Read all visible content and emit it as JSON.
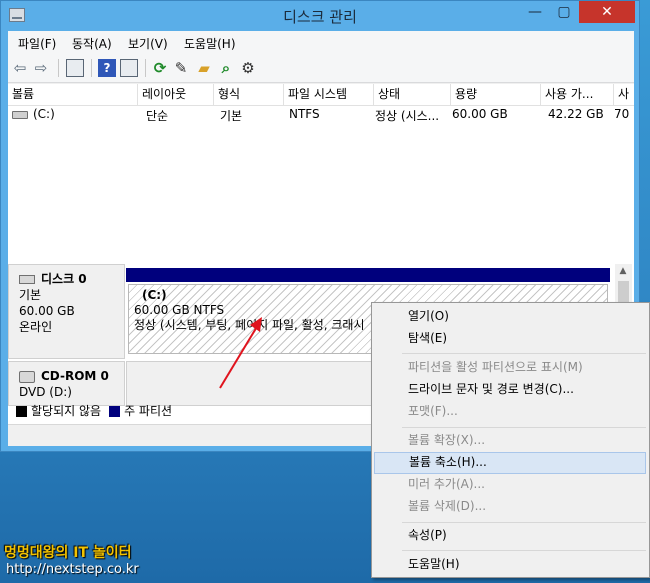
{
  "window": {
    "title": "디스크 관리",
    "controls": {
      "minimize": "—",
      "maximize": "▢",
      "close": "✕"
    }
  },
  "menubar": [
    {
      "label": "파일(F)"
    },
    {
      "label": "동작(A)"
    },
    {
      "label": "보기(V)"
    },
    {
      "label": "도움말(H)"
    }
  ],
  "toolbar": {
    "icons": [
      "back-arrow-icon",
      "forward-arrow-icon",
      "console-tree-icon",
      "help-icon",
      "properties-view-icon",
      "refresh-icon",
      "properties-icon",
      "open-folder-icon",
      "search-icon",
      "settings-icon"
    ],
    "help_glyph": "?"
  },
  "volume_list": {
    "columns": [
      "볼륨",
      "레이아웃",
      "형식",
      "파일 시스템",
      "상태",
      "용량",
      "사용 가...",
      "사"
    ],
    "rows": [
      {
        "volume": "(C:)",
        "layout": "단순",
        "type": "기본",
        "filesystem": "NTFS",
        "status": "정상 (시스...",
        "capacity": "60.00 GB",
        "free": "42.22 GB",
        "pct": "70"
      }
    ]
  },
  "disks": {
    "disk0": {
      "title": "디스크 0",
      "kind": "기본",
      "size": "60.00 GB",
      "state": "온라인",
      "partition": {
        "name": "(C:)",
        "size_fs": "60.00 GB NTFS",
        "status": "정상 (시스템, 부팅, 페이지 파일, 활성, 크래시"
      }
    },
    "cdrom0": {
      "title": "CD-ROM 0",
      "drive": "DVD (D:)"
    }
  },
  "legend": {
    "items": [
      {
        "label": "할당되지 않음",
        "color": "#000000"
      },
      {
        "label": "주 파티션",
        "color": "#00007d"
      }
    ]
  },
  "context_menu": {
    "items": [
      {
        "label": "열기(O)",
        "enabled": true
      },
      {
        "label": "탐색(E)",
        "enabled": true
      },
      {
        "label": "파티션을 활성 파티션으로 표시(M)",
        "enabled": false
      },
      {
        "label": "드라이브 문자 및 경로 변경(C)...",
        "enabled": true
      },
      {
        "label": "포맷(F)...",
        "enabled": false
      },
      {
        "label": "볼륨 확장(X)...",
        "enabled": false
      },
      {
        "label": "볼륨 축소(H)...",
        "enabled": true,
        "highlighted": true
      },
      {
        "label": "미러 추가(A)...",
        "enabled": false
      },
      {
        "label": "볼륨 삭제(D)...",
        "enabled": false
      },
      {
        "label": "속성(P)",
        "enabled": true
      },
      {
        "label": "도움말(H)",
        "enabled": true
      }
    ]
  },
  "watermark": {
    "line1": "멍멍대왕의 IT 놀이터",
    "line2": "http://nextstep.co.kr"
  },
  "colors": {
    "titlebar": "#5aaee8",
    "close_button": "#c6342b",
    "primary_partition": "#00007d",
    "menu_highlight": "#d9e6f5",
    "annotation_arrow": "#e0141e",
    "watermark_text": "#f2c200"
  }
}
